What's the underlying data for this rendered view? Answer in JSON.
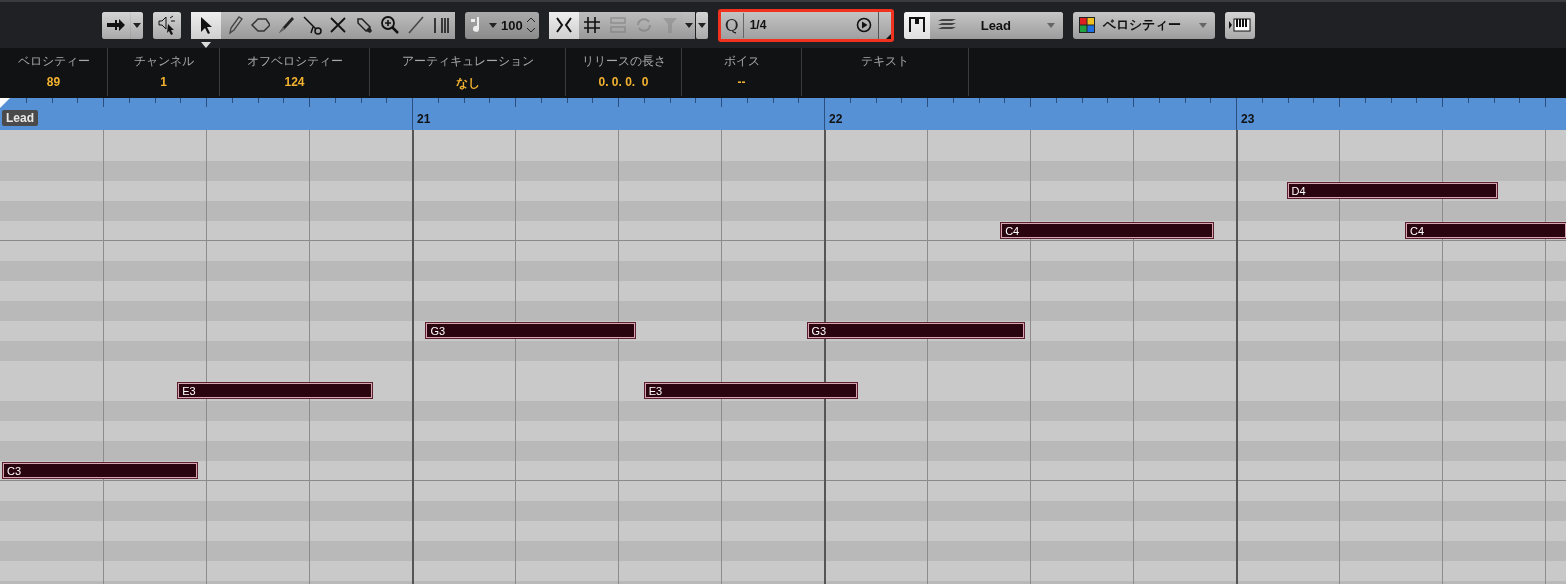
{
  "toolbar": {
    "tools": [
      {
        "kind": "select",
        "selected": true
      },
      {
        "kind": "draw",
        "selected": false
      },
      {
        "kind": "erase",
        "selected": false
      },
      {
        "kind": "trim",
        "selected": false
      },
      {
        "kind": "split",
        "selected": false
      },
      {
        "kind": "mute",
        "selected": false
      },
      {
        "kind": "glue",
        "selected": false
      },
      {
        "kind": "zoom",
        "selected": false
      },
      {
        "kind": "line",
        "selected": false
      },
      {
        "kind": "comb",
        "selected": false
      }
    ],
    "insert_velocity": "100",
    "snap": [
      {
        "kind": "snap",
        "on": true,
        "disabled": false
      },
      {
        "kind": "grid",
        "on": false,
        "disabled": false
      },
      {
        "kind": "relative",
        "on": false,
        "disabled": true
      },
      {
        "kind": "cycle",
        "on": false,
        "disabled": true
      },
      {
        "kind": "funnel",
        "on": false,
        "disabled": true
      }
    ],
    "quantize": {
      "label": "Q",
      "value": "1/4",
      "highlighted": true
    },
    "part_lock": {
      "on": true
    },
    "part": "Lead",
    "color_scheme": "ベロシティー"
  },
  "info_line": [
    {
      "label": "ベロシティー",
      "value": "89"
    },
    {
      "label": "チャンネル",
      "value": "1"
    },
    {
      "label": "オフベロシティー",
      "value": "124"
    },
    {
      "label": "アーティキュレーション",
      "value": "なし"
    },
    {
      "label": "リリースの長さ",
      "value": "0. 0. 0.  0"
    },
    {
      "label": "ボイス",
      "value": "--"
    },
    {
      "label": "テキスト"
    }
  ],
  "ruler": {
    "part_label": "Lead",
    "bars": [
      "21",
      "22",
      "23"
    ]
  },
  "notes": [
    {
      "label": "C3"
    },
    {
      "label": "E3"
    },
    {
      "label": "G3"
    },
    {
      "label": "E3"
    },
    {
      "label": "G3"
    },
    {
      "label": "C4"
    },
    {
      "label": "D4"
    },
    {
      "label": "C4"
    }
  ]
}
